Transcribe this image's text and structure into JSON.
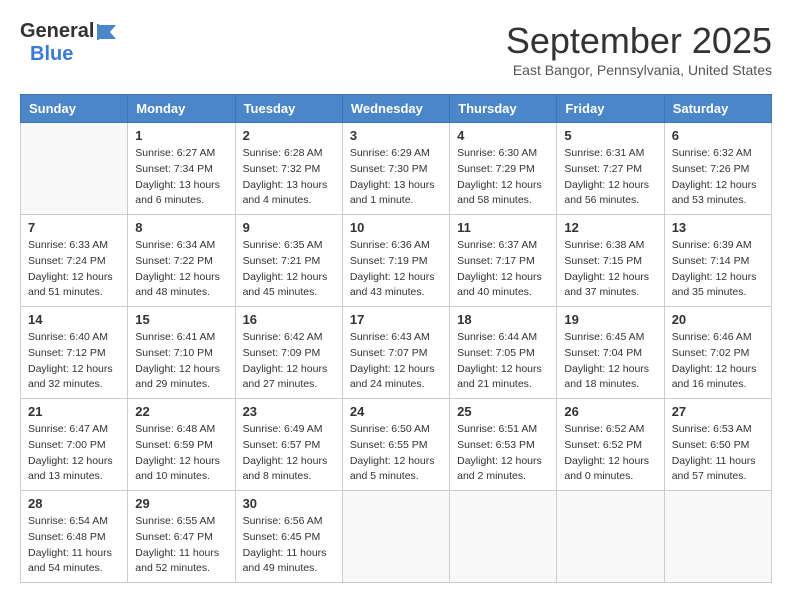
{
  "logo": {
    "general": "General",
    "blue": "Blue"
  },
  "header": {
    "month_title": "September 2025",
    "subtitle": "East Bangor, Pennsylvania, United States"
  },
  "weekdays": [
    "Sunday",
    "Monday",
    "Tuesday",
    "Wednesday",
    "Thursday",
    "Friday",
    "Saturday"
  ],
  "weeks": [
    [
      {
        "day": "",
        "info": ""
      },
      {
        "day": "1",
        "info": "Sunrise: 6:27 AM\nSunset: 7:34 PM\nDaylight: 13 hours\nand 6 minutes."
      },
      {
        "day": "2",
        "info": "Sunrise: 6:28 AM\nSunset: 7:32 PM\nDaylight: 13 hours\nand 4 minutes."
      },
      {
        "day": "3",
        "info": "Sunrise: 6:29 AM\nSunset: 7:30 PM\nDaylight: 13 hours\nand 1 minute."
      },
      {
        "day": "4",
        "info": "Sunrise: 6:30 AM\nSunset: 7:29 PM\nDaylight: 12 hours\nand 58 minutes."
      },
      {
        "day": "5",
        "info": "Sunrise: 6:31 AM\nSunset: 7:27 PM\nDaylight: 12 hours\nand 56 minutes."
      },
      {
        "day": "6",
        "info": "Sunrise: 6:32 AM\nSunset: 7:26 PM\nDaylight: 12 hours\nand 53 minutes."
      }
    ],
    [
      {
        "day": "7",
        "info": "Sunrise: 6:33 AM\nSunset: 7:24 PM\nDaylight: 12 hours\nand 51 minutes."
      },
      {
        "day": "8",
        "info": "Sunrise: 6:34 AM\nSunset: 7:22 PM\nDaylight: 12 hours\nand 48 minutes."
      },
      {
        "day": "9",
        "info": "Sunrise: 6:35 AM\nSunset: 7:21 PM\nDaylight: 12 hours\nand 45 minutes."
      },
      {
        "day": "10",
        "info": "Sunrise: 6:36 AM\nSunset: 7:19 PM\nDaylight: 12 hours\nand 43 minutes."
      },
      {
        "day": "11",
        "info": "Sunrise: 6:37 AM\nSunset: 7:17 PM\nDaylight: 12 hours\nand 40 minutes."
      },
      {
        "day": "12",
        "info": "Sunrise: 6:38 AM\nSunset: 7:15 PM\nDaylight: 12 hours\nand 37 minutes."
      },
      {
        "day": "13",
        "info": "Sunrise: 6:39 AM\nSunset: 7:14 PM\nDaylight: 12 hours\nand 35 minutes."
      }
    ],
    [
      {
        "day": "14",
        "info": "Sunrise: 6:40 AM\nSunset: 7:12 PM\nDaylight: 12 hours\nand 32 minutes."
      },
      {
        "day": "15",
        "info": "Sunrise: 6:41 AM\nSunset: 7:10 PM\nDaylight: 12 hours\nand 29 minutes."
      },
      {
        "day": "16",
        "info": "Sunrise: 6:42 AM\nSunset: 7:09 PM\nDaylight: 12 hours\nand 27 minutes."
      },
      {
        "day": "17",
        "info": "Sunrise: 6:43 AM\nSunset: 7:07 PM\nDaylight: 12 hours\nand 24 minutes."
      },
      {
        "day": "18",
        "info": "Sunrise: 6:44 AM\nSunset: 7:05 PM\nDaylight: 12 hours\nand 21 minutes."
      },
      {
        "day": "19",
        "info": "Sunrise: 6:45 AM\nSunset: 7:04 PM\nDaylight: 12 hours\nand 18 minutes."
      },
      {
        "day": "20",
        "info": "Sunrise: 6:46 AM\nSunset: 7:02 PM\nDaylight: 12 hours\nand 16 minutes."
      }
    ],
    [
      {
        "day": "21",
        "info": "Sunrise: 6:47 AM\nSunset: 7:00 PM\nDaylight: 12 hours\nand 13 minutes."
      },
      {
        "day": "22",
        "info": "Sunrise: 6:48 AM\nSunset: 6:59 PM\nDaylight: 12 hours\nand 10 minutes."
      },
      {
        "day": "23",
        "info": "Sunrise: 6:49 AM\nSunset: 6:57 PM\nDaylight: 12 hours\nand 8 minutes."
      },
      {
        "day": "24",
        "info": "Sunrise: 6:50 AM\nSunset: 6:55 PM\nDaylight: 12 hours\nand 5 minutes."
      },
      {
        "day": "25",
        "info": "Sunrise: 6:51 AM\nSunset: 6:53 PM\nDaylight: 12 hours\nand 2 minutes."
      },
      {
        "day": "26",
        "info": "Sunrise: 6:52 AM\nSunset: 6:52 PM\nDaylight: 12 hours\nand 0 minutes."
      },
      {
        "day": "27",
        "info": "Sunrise: 6:53 AM\nSunset: 6:50 PM\nDaylight: 11 hours\nand 57 minutes."
      }
    ],
    [
      {
        "day": "28",
        "info": "Sunrise: 6:54 AM\nSunset: 6:48 PM\nDaylight: 11 hours\nand 54 minutes."
      },
      {
        "day": "29",
        "info": "Sunrise: 6:55 AM\nSunset: 6:47 PM\nDaylight: 11 hours\nand 52 minutes."
      },
      {
        "day": "30",
        "info": "Sunrise: 6:56 AM\nSunset: 6:45 PM\nDaylight: 11 hours\nand 49 minutes."
      },
      {
        "day": "",
        "info": ""
      },
      {
        "day": "",
        "info": ""
      },
      {
        "day": "",
        "info": ""
      },
      {
        "day": "",
        "info": ""
      }
    ]
  ]
}
